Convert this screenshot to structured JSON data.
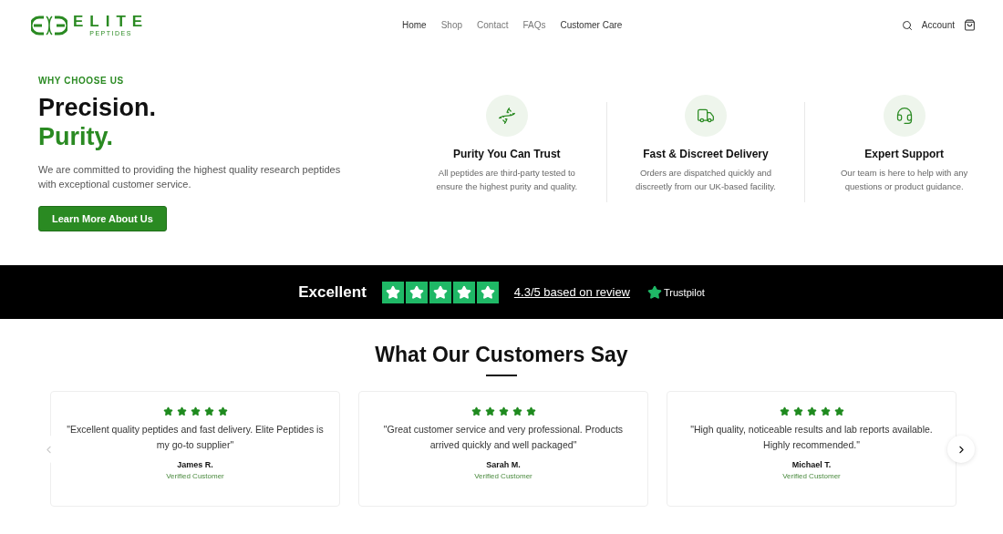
{
  "header": {
    "logo": {
      "title": "ELITE",
      "subtitle": "PEPTIDES"
    },
    "nav": [
      {
        "label": "Home",
        "highlighted": true
      },
      {
        "label": "Shop",
        "highlighted": false
      },
      {
        "label": "Contact",
        "highlighted": false
      },
      {
        "label": "FAQs",
        "highlighted": false
      },
      {
        "label": "Customer Care",
        "highlighted": true
      }
    ],
    "account": "Account"
  },
  "hero": {
    "eyebrow": "WHY CHOOSE US",
    "headline_1": "Precision.",
    "headline_2": "Purity.",
    "body": "We are committed to providing the highest quality research peptides with exceptional customer service.",
    "button": "Learn More About Us"
  },
  "features": [
    {
      "kind": "dna",
      "title": "Purity You Can Trust",
      "text": "All peptides are third-party tested to ensure the highest purity and quality."
    },
    {
      "kind": "truck",
      "title": "Fast & Discreet Delivery",
      "text": "Orders are dispatched quickly and discreetly from our UK-based facility."
    },
    {
      "kind": "headset",
      "title": "Expert Support",
      "text": "Our team is here to help with any questions or product guidance."
    }
  ],
  "trust_bar": {
    "rating_word": "Excellent",
    "stars": 5,
    "rating_link": "4.3/5 based on review",
    "brand": "Trustpilot"
  },
  "testimonials": {
    "title": "What Our Customers Say",
    "reviews": [
      {
        "stars": 5,
        "quote": "\"Excellent quality peptides and fast delivery. Elite Peptides is my go-to supplier\"",
        "name": "James R.",
        "role": "Verified Customer"
      },
      {
        "stars": 5,
        "quote": "\"Great customer service and very professional. Products arrived quickly and well packaged\"",
        "name": "Sarah M.",
        "role": "Verified Customer"
      },
      {
        "stars": 5,
        "quote": "\"High quality, noticeable results and lab reports available. Highly recommended.\"",
        "name": "Michael T.",
        "role": "Verified Customer"
      }
    ]
  }
}
